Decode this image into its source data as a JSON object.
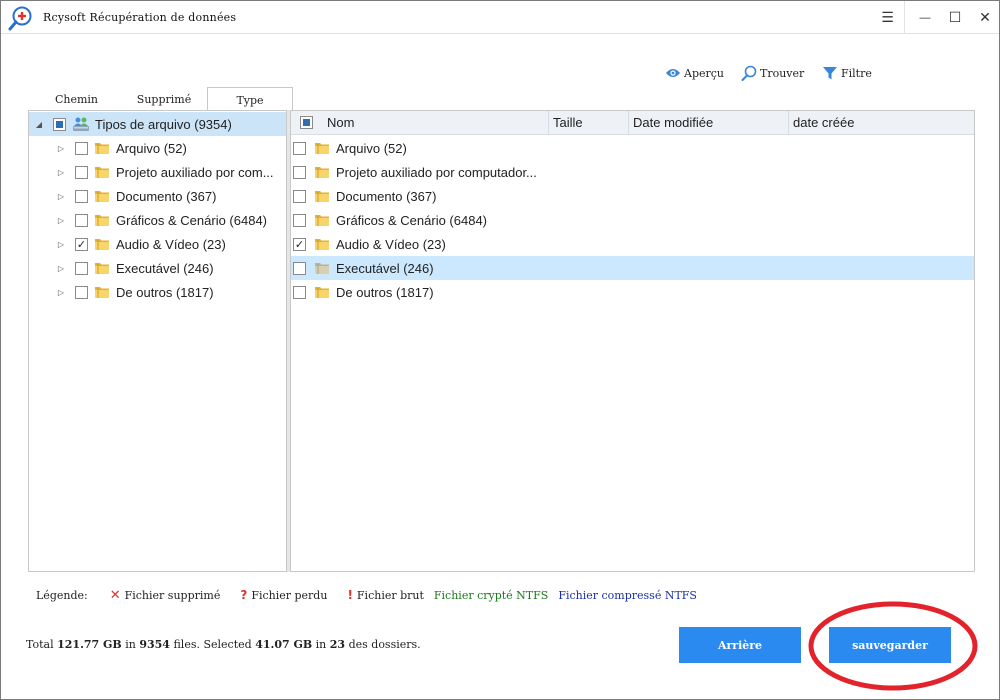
{
  "window": {
    "title": "Rcysoft Récupération de données",
    "controls": {
      "menu": "☰",
      "minimize": "—",
      "maximize": "☐",
      "close": "✕"
    }
  },
  "toolbar": {
    "preview_label": "Aperçu",
    "find_label": "Trouver",
    "filter_label": "Filtre",
    "preview_icon": "eye-icon",
    "find_icon": "magnifier-icon",
    "filter_icon": "funnel-icon"
  },
  "tabs": [
    {
      "label": "Chemin"
    },
    {
      "label": "Supprimé"
    },
    {
      "label": "Type",
      "active": true
    }
  ],
  "tree": {
    "root": {
      "label": "Tipos de arquivo (9354)",
      "state": "partial",
      "icon": "drive-users-icon"
    },
    "items": [
      {
        "label": "Arquivo (52)",
        "checked": false
      },
      {
        "label": "Projeto auxiliado por com...",
        "checked": false
      },
      {
        "label": "Documento (367)",
        "checked": false
      },
      {
        "label": "Gráficos & Cenário (6484)",
        "checked": false
      },
      {
        "label": "Audio & Vídeo (23)",
        "checked": true
      },
      {
        "label": "Executável (246)",
        "checked": false
      },
      {
        "label": "De outros (1817)",
        "checked": false
      }
    ]
  },
  "table": {
    "columns": [
      "Nom",
      "Taille",
      "Date modifiée",
      "date créée"
    ],
    "rows": [
      {
        "name": "Arquivo (52)",
        "checked": false,
        "selected": false
      },
      {
        "name": "Projeto auxiliado por computador...",
        "checked": false,
        "selected": false
      },
      {
        "name": "Documento (367)",
        "checked": false,
        "selected": false
      },
      {
        "name": "Gráficos & Cenário (6484)",
        "checked": false,
        "selected": false
      },
      {
        "name": "Audio & Vídeo (23)",
        "checked": true,
        "selected": false
      },
      {
        "name": "Executável (246)",
        "checked": false,
        "selected": true
      },
      {
        "name": "De outros (1817)",
        "checked": false,
        "selected": false
      }
    ]
  },
  "legend": {
    "title": "Légende:",
    "deleted_symbol": "✕",
    "deleted": "Fichier supprimé",
    "lost_symbol": "?",
    "lost": "Fichier perdu",
    "raw_symbol": "!",
    "raw": "Fichier brut",
    "encrypted": "Fichier crypté NTFS",
    "compressed": "Fichier compressé NTFS",
    "colors": {
      "deleted": "#e0322b",
      "encrypted": "#1a7a1a",
      "compressed": "#1a2fa8"
    }
  },
  "status": {
    "prefix": "Total",
    "total_size": "121.77 GB",
    "in_label": "in",
    "total_files": "9354",
    "files_label": "files. Selected",
    "selected_size": "41.07 GB",
    "in_label2": "in",
    "selected_count": "23",
    "folders_label": "des dossiers."
  },
  "buttons": {
    "back_label": "Arrière",
    "save_label": "sauvegarder",
    "accent": "#2b8af0"
  }
}
